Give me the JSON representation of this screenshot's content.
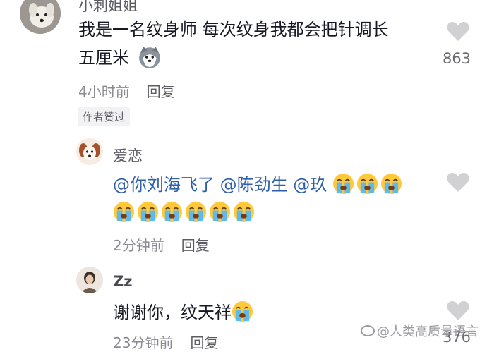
{
  "comments": [
    {
      "username": "小刺姐姐",
      "text_line1": "我是一名纹身师 每次纹身我都会把针调长",
      "text_line2": "五厘米",
      "time": "4小时前",
      "reply": "回复",
      "likes": "863",
      "badge": "作者赞过"
    },
    {
      "username": "爱恋",
      "mention1": "@你刘海飞了",
      "mention2": "@陈劲生",
      "mention3": "@玖",
      "time": "2分钟前",
      "reply": "回复"
    },
    {
      "username": "Zz",
      "text": "谢谢你，纹天祥",
      "time": "23分钟前",
      "reply": "回复",
      "likes": "376"
    }
  ],
  "icons": {
    "like": "heart-icon",
    "crying": "crying-emoji-icon",
    "husky": "husky-emoji-icon"
  },
  "colors": {
    "mention": "#2f5fa8",
    "heart": "#d1d1d4",
    "meta": "#8a8a92"
  },
  "watermark": "@人类高质量语言"
}
